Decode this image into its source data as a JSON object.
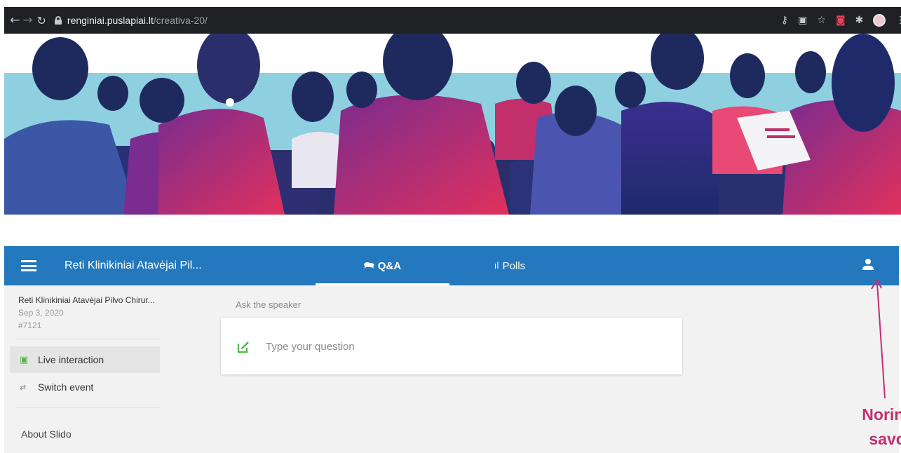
{
  "browser": {
    "url_host": "renginiai.puslapiai.lt",
    "url_path": "/creativa-20/"
  },
  "appbar": {
    "event_title": "Reti Klinikiniai Atavėjai Pil...",
    "tabs": [
      {
        "label": "Q&A",
        "icon": "chat-bubbles-icon",
        "active": true
      },
      {
        "label": "Polls",
        "icon": "bar-chart-icon",
        "active": false
      }
    ]
  },
  "sidebar": {
    "event_name": "Reti Klinikiniai Atavėjai Pilvo Chirur...",
    "date": "Sep 3, 2020",
    "code": "#7121",
    "items": [
      {
        "label": "Live interaction",
        "icon": "chat-icon",
        "active": true
      },
      {
        "label": "Switch event",
        "icon": "swap-icon",
        "active": false
      }
    ],
    "about": "About Slido"
  },
  "main": {
    "ask_label": "Ask the speaker",
    "question_placeholder": "Type your question"
  },
  "annotation": {
    "line1": "Norint",
    "line2": "savo v"
  },
  "colors": {
    "appbar": "#2478bd",
    "accent_green": "#50b848",
    "annotation": "#c42f6e"
  }
}
